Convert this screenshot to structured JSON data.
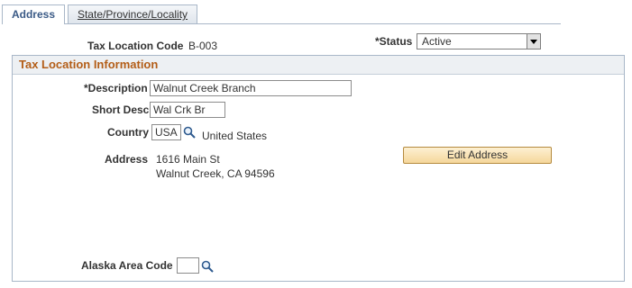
{
  "tabs": [
    {
      "label": "Address"
    },
    {
      "label": "State/Province/Locality"
    }
  ],
  "header": {
    "tax_location_code_label": "Tax Location Code",
    "tax_location_code_value": "B-003",
    "status_label": "*Status",
    "status_value": "Active"
  },
  "section": {
    "title": "Tax Location Information",
    "description_label": "*Description",
    "description_value": "Walnut Creek Branch",
    "short_desc_label": "Short Desc",
    "short_desc_value": "Wal Crk Br",
    "country_label": "Country",
    "country_code": "USA",
    "country_name": "United States",
    "address_label": "Address",
    "address_line1": "1616 Main St",
    "address_line2": "Walnut Creek, CA 94596",
    "edit_address_label": "Edit Address",
    "alaska_area_code_label": "Alaska Area Code",
    "alaska_area_code_value": ""
  },
  "icons": {
    "lookup": "magnifying-glass-icon",
    "dropdown": "chevron-down-icon"
  },
  "colors": {
    "section_title": "#b35d17",
    "active_tab_text": "#3a5a86",
    "button_fill": "#f5d79b",
    "border": "#a9b7c8"
  }
}
